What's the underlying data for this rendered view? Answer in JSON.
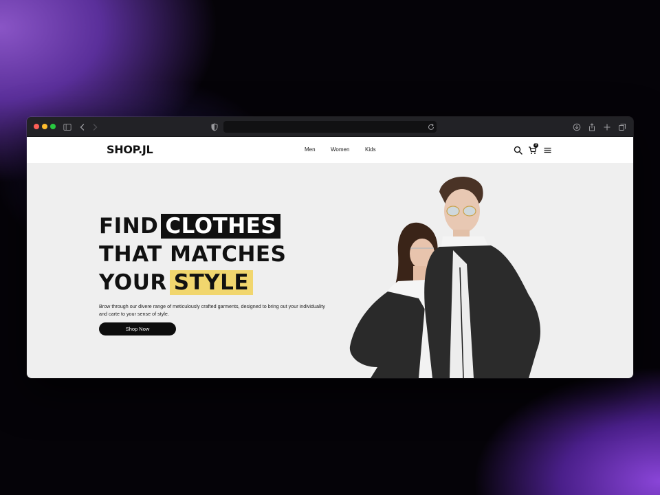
{
  "browser": {
    "icons": [
      "close-dot",
      "minimize-dot",
      "zoom-dot",
      "sidebar-icon",
      "back-icon",
      "forward-icon",
      "shield-icon",
      "reload-icon",
      "download-icon",
      "share-icon",
      "new-tab-icon",
      "tabs-overview-icon"
    ]
  },
  "site": {
    "logo": "SHOP.JL",
    "nav": {
      "men": "Men",
      "women": "Women",
      "kids": "Kids"
    },
    "cart_count": "0",
    "icons": [
      "search-icon",
      "cart-icon",
      "menu-icon"
    ]
  },
  "hero": {
    "line1_plain": "FIND",
    "line1_highlight": "CLOTHES",
    "line2": "THAT MATCHES",
    "line3_plain": "YOUR",
    "line3_highlight": "STYLE",
    "description": "Brow through our divere range of meticulously crafted garments, designed to bring out your individuality and carte to your sense of style.",
    "cta": "Shop Now"
  },
  "colors": {
    "highlight_black": "#111111",
    "highlight_yellow": "#f1d66e",
    "hero_bg": "#efefef"
  }
}
